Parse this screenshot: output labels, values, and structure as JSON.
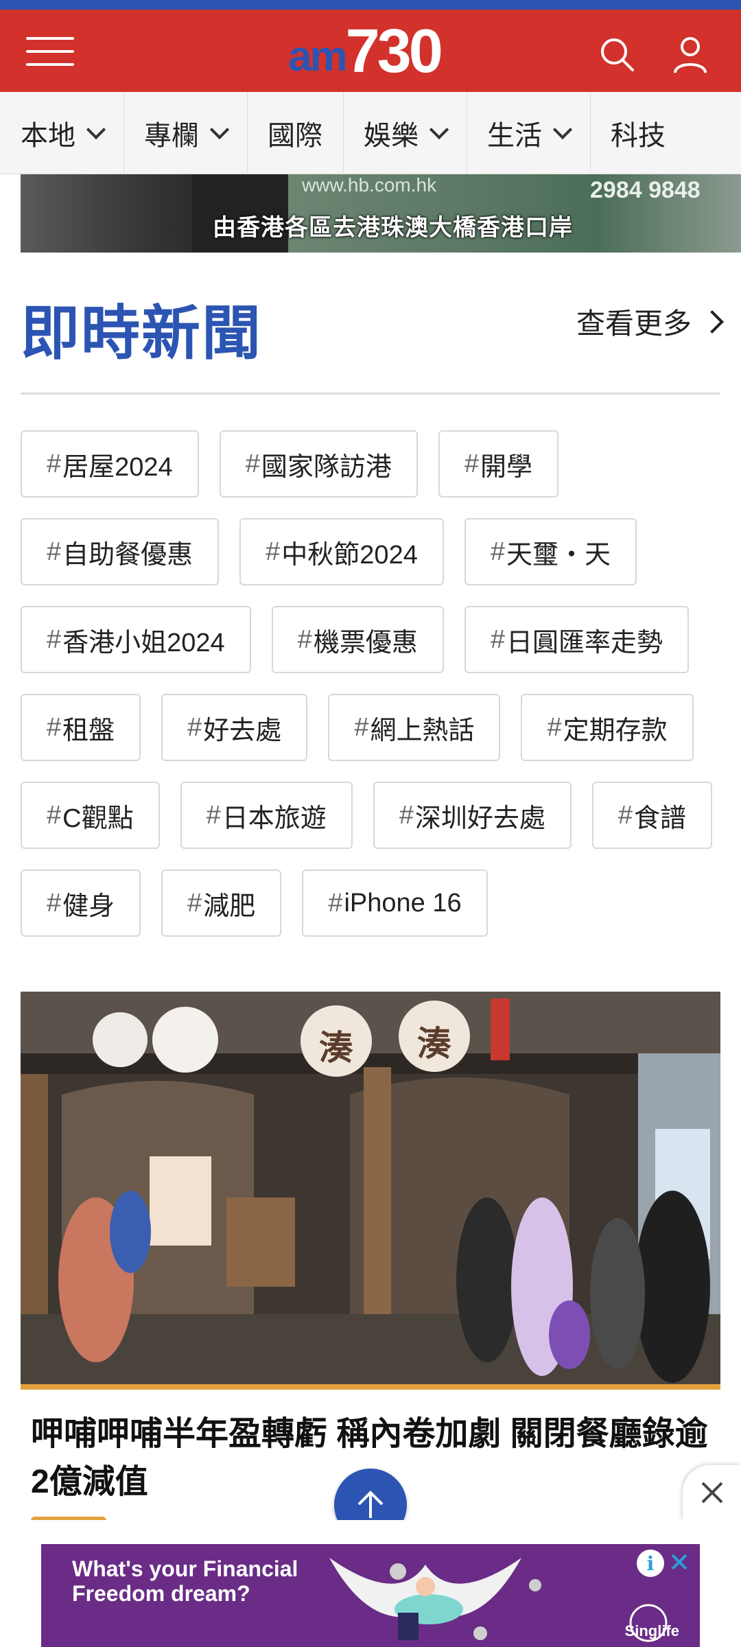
{
  "header": {
    "logo_am": "am",
    "logo_num": "730",
    "icons": [
      "menu-icon",
      "search-icon",
      "user-icon"
    ],
    "brand_color": "#d2312c",
    "accent_color": "#2c55b3"
  },
  "nav": {
    "items": [
      {
        "label": "本地",
        "dropdown": true
      },
      {
        "label": "專欄",
        "dropdown": true
      },
      {
        "label": "國際",
        "dropdown": false
      },
      {
        "label": "娛樂",
        "dropdown": true
      },
      {
        "label": "生活",
        "dropdown": true
      },
      {
        "label": "科技",
        "dropdown": false
      }
    ]
  },
  "banner": {
    "url_text": "www.hb.com.hk",
    "phone_text": "2984 9848",
    "caption": "由香港各區去港珠澳大橋香港口岸"
  },
  "section": {
    "title": "即時新聞",
    "see_more": "查看更多"
  },
  "tags": [
    {
      "hash": "#",
      "label": "居屋2024"
    },
    {
      "hash": "#",
      "label": "國家隊訪港"
    },
    {
      "hash": "#",
      "label": "開學"
    },
    {
      "hash": "#",
      "label": "自助餐優惠"
    },
    {
      "hash": "#",
      "label": "中秋節2024"
    },
    {
      "hash": "#",
      "label": "天璽・天"
    },
    {
      "hash": "#",
      "label": "香港小姐2024"
    },
    {
      "hash": "#",
      "label": "機票優惠"
    },
    {
      "hash": "#",
      "label": "日圓匯率走勢"
    },
    {
      "hash": "#",
      "label": "租盤"
    },
    {
      "hash": "#",
      "label": "好去處"
    },
    {
      "hash": "#",
      "label": "網上熱話"
    },
    {
      "hash": "#",
      "label": "定期存款"
    },
    {
      "hash": "#",
      "label": "C觀點"
    },
    {
      "hash": "#",
      "label": "日本旅遊"
    },
    {
      "hash": "#",
      "label": "深圳好去處"
    },
    {
      "hash": "#",
      "label": "食譜"
    },
    {
      "hash": "#",
      "label": "健身"
    },
    {
      "hash": "#",
      "label": "減肥"
    },
    {
      "hash": "#",
      "label": "iPhone 16"
    }
  ],
  "article": {
    "image_sign_chars": [
      "湊",
      "湊"
    ],
    "headline": "呷哺呷哺半年盈轉虧 稱內卷加劇 關閉餐廳錄逾2億減值",
    "category_color": "#e2a13c"
  },
  "ad": {
    "text": "What's your Financial Freedom dream?",
    "brand": "Singlife",
    "info_glyph": "i",
    "bg_color": "#6a2c86"
  }
}
